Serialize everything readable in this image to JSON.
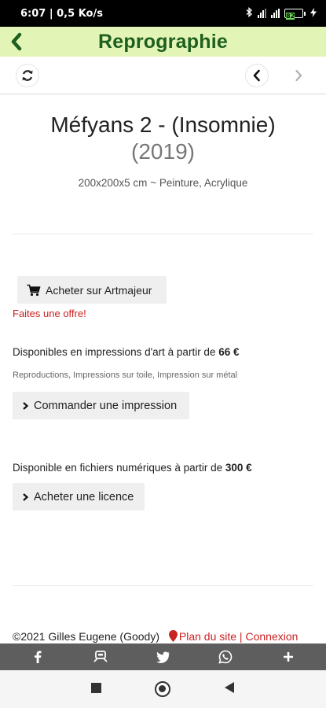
{
  "status_bar": {
    "time_speed": "6:07 | 0,5 Ko/s",
    "battery": "82"
  },
  "header": {
    "title": "Reprographie"
  },
  "artwork": {
    "title": "Méfyans 2 - (Insomnie)",
    "year": "(2019)",
    "details": "200x200x5 cm ~ Peinture, Acrylique"
  },
  "actions": {
    "buy_label": "Acheter sur Artmajeur",
    "offer_link": "Faites une offre!",
    "prints_text": "Disponibles en impressions d'art à partir de ",
    "prints_price": "66 €",
    "prints_types": "Reproductions, Impressions sur toile, Impression sur métal",
    "order_label": "Commander une impression",
    "digital_text": "Disponible en fichiers numériques à partir de ",
    "digital_price": "300 €",
    "licence_label": "Acheter une licence"
  },
  "footer": {
    "copyright": "©2021 Gilles Eugene (Goody)",
    "sitemap": "Plan du site",
    "separator": " | ",
    "login": "Connexion"
  },
  "share": {
    "items": [
      "facebook-icon",
      "pinterest-icon",
      "twitter-icon",
      "whatsapp-icon",
      "plus-icon"
    ]
  },
  "colors": {
    "header_bg": "#e3f4b7",
    "header_text": "#1e5e1e",
    "link_red": "#c82222",
    "share_bar": "#5e5e5e"
  }
}
